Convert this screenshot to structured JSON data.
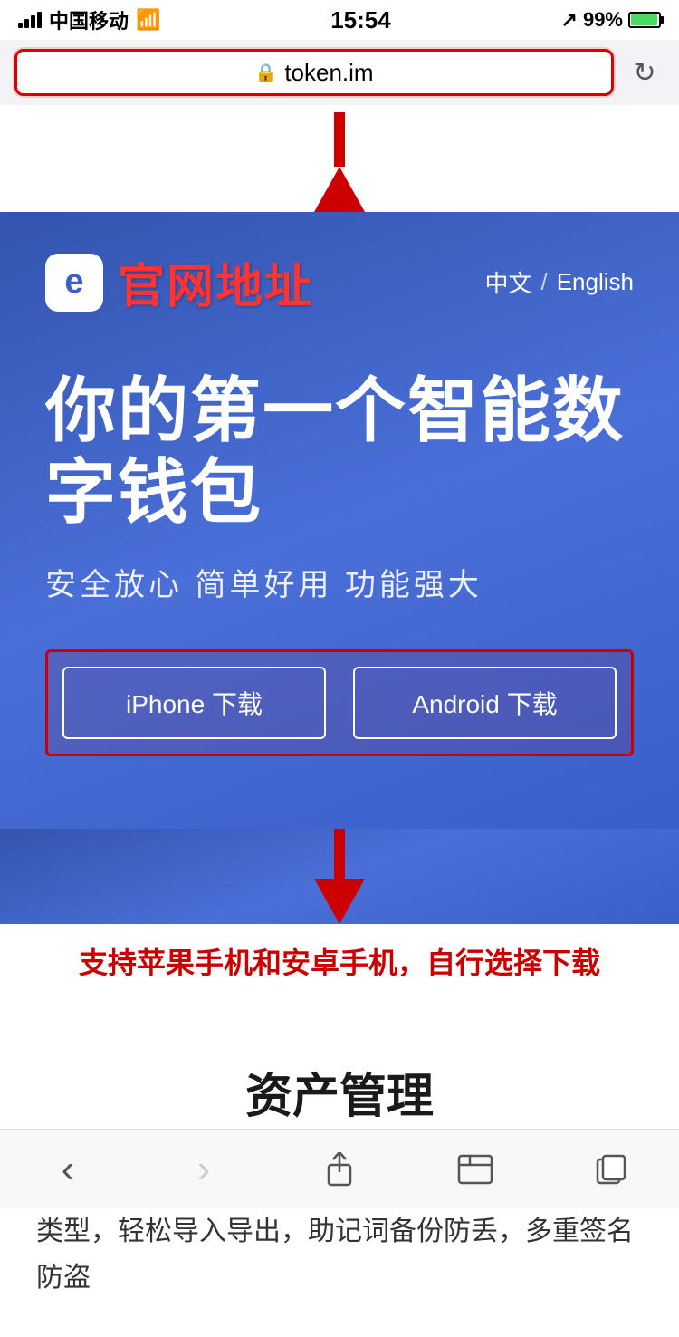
{
  "statusBar": {
    "carrier": "中国移动",
    "time": "15:54",
    "battery": "99%",
    "signal": "full"
  },
  "browserBar": {
    "url": "token.im",
    "refreshLabel": "↻"
  },
  "annotations": {
    "arrowUrl": "↑",
    "bottomText": "支持苹果手机和安卓手机，自行选择下载"
  },
  "header": {
    "logoChar": "e",
    "siteTitle": "官网地址",
    "langChinese": "中文",
    "langSeparator": "/",
    "langEnglish": "English"
  },
  "hero": {
    "title": "你的第一个智能数字钱包",
    "subtitle": "安全放心  简单好用  功能强大"
  },
  "downloads": {
    "iphoneLabel": "iPhone 下载",
    "androidLabel": "Android 下载"
  },
  "assetSection": {
    "title": "资产管理",
    "body": "私钥本地安全保存，资产一目了然，支持多种钱包类型，轻松导入导出，助记词备份防丢，多重签名防盗"
  },
  "bottomToolbar": {
    "backIcon": "‹",
    "forwardIcon": "›",
    "shareIcon": "⬆",
    "bookmarkIcon": "📖",
    "tabsIcon": "⧉"
  }
}
